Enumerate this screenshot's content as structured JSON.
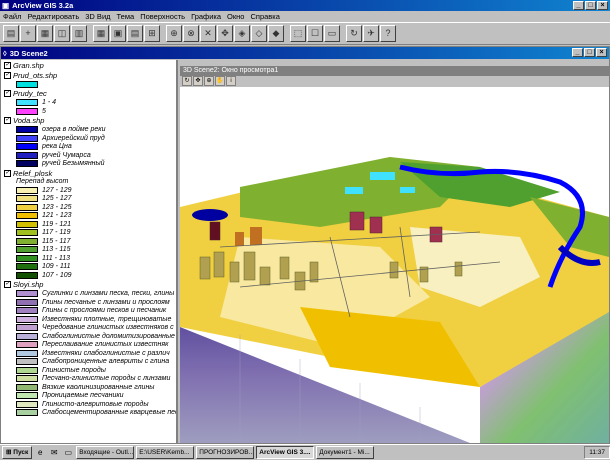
{
  "app": {
    "title": "ArcView GIS 3.2a",
    "menu": [
      "Файл",
      "Редактировать",
      "3D Вид",
      "Тема",
      "Поверхность",
      "Графика",
      "Окно",
      "Справка"
    ]
  },
  "doc": {
    "title": "3D Scene2"
  },
  "viewer": {
    "title": "3D Scene2: Окно просмотра1"
  },
  "toc": {
    "themes": [
      {
        "name": "Gran.shp",
        "checked": true,
        "items": []
      },
      {
        "name": "Prud_ots.shp",
        "checked": true,
        "items": [
          {
            "label": "",
            "color": "#00e0e0"
          }
        ]
      },
      {
        "name": "Prudy_tec",
        "checked": true,
        "items": [
          {
            "label": "1 - 4",
            "color": "#40e0ff"
          },
          {
            "label": "5",
            "color": "#ff40ff"
          }
        ]
      },
      {
        "name": "Voda.shp",
        "checked": true,
        "items": [
          {
            "label": "озера в пойме реки",
            "color": "#0000a0"
          },
          {
            "label": "Архиерейский пруд",
            "color": "#4040ff"
          },
          {
            "label": "река Цна",
            "color": "#0000ff"
          },
          {
            "label": "ручей Чумарса",
            "color": "#2020c0"
          },
          {
            "label": "ручей Безымянный",
            "color": "#000060"
          }
        ]
      },
      {
        "name": "Relef_plosk",
        "checked": true,
        "subtitle": "Перепад высот",
        "items": [
          {
            "label": "127 - 129",
            "color": "#f8f0b0"
          },
          {
            "label": "125 - 127",
            "color": "#f0e080"
          },
          {
            "label": "123 - 125",
            "color": "#f0d040"
          },
          {
            "label": "121 - 123",
            "color": "#f0c000"
          },
          {
            "label": "119 - 121",
            "color": "#d0c000"
          },
          {
            "label": "117 - 119",
            "color": "#a0c020"
          },
          {
            "label": "115 - 117",
            "color": "#80b030"
          },
          {
            "label": "113 - 115",
            "color": "#50a030"
          },
          {
            "label": "111 - 113",
            "color": "#309020"
          },
          {
            "label": "109 - 111",
            "color": "#207010"
          },
          {
            "label": "107 - 109",
            "color": "#105000"
          }
        ]
      },
      {
        "name": "Sloyi.shp",
        "checked": true,
        "items": [
          {
            "label": "Суглинки с линзами песка, пески, глины",
            "color": "#b090d0"
          },
          {
            "label": "Глины песчаные с линзами и прослоям",
            "color": "#9070b0"
          },
          {
            "label": "Глины с прослоями песков и песчаник",
            "color": "#a080c0"
          },
          {
            "label": "Известняки плотные, трещиноватые",
            "color": "#d0b0e0"
          },
          {
            "label": "Чередование глинистых известняков с",
            "color": "#c0a0d0"
          },
          {
            "label": "Слабоглинистые доломитизированные",
            "color": "#b8b0d8"
          },
          {
            "label": "Переслаивание глинистых известняк",
            "color": "#e0a0c0"
          },
          {
            "label": "Известняки слабоглинистые с различ",
            "color": "#b0c8e0"
          },
          {
            "label": "Слабопрониценные алевриты с глина",
            "color": "#c0c0c0"
          },
          {
            "label": "Глинистые породы",
            "color": "#b0d890"
          },
          {
            "label": "Песчано-глинистые породы с линзами",
            "color": "#d0e0a0"
          },
          {
            "label": "Вязкие каолинизированные глины",
            "color": "#90b870"
          },
          {
            "label": "Проницаемые песчаники",
            "color": "#c0e8b0"
          },
          {
            "label": "Глинисто-алевритовые породы",
            "color": "#e0e8c0"
          },
          {
            "label": "Слабосцементированные кварцевые пес",
            "color": "#a8d0a0"
          }
        ]
      }
    ]
  },
  "taskbar": {
    "start": "Пуск",
    "tasks": [
      "Входящие - Outl...",
      "E:\\USER\\Kemb...",
      "ПРОГНОЗИРОВ...",
      "ArcView GIS 3....",
      "Документ1 - Mi..."
    ],
    "active": 3,
    "clock": "11:37"
  },
  "colors": {
    "titlebar": "#000080",
    "face": "#c0c0c0"
  }
}
